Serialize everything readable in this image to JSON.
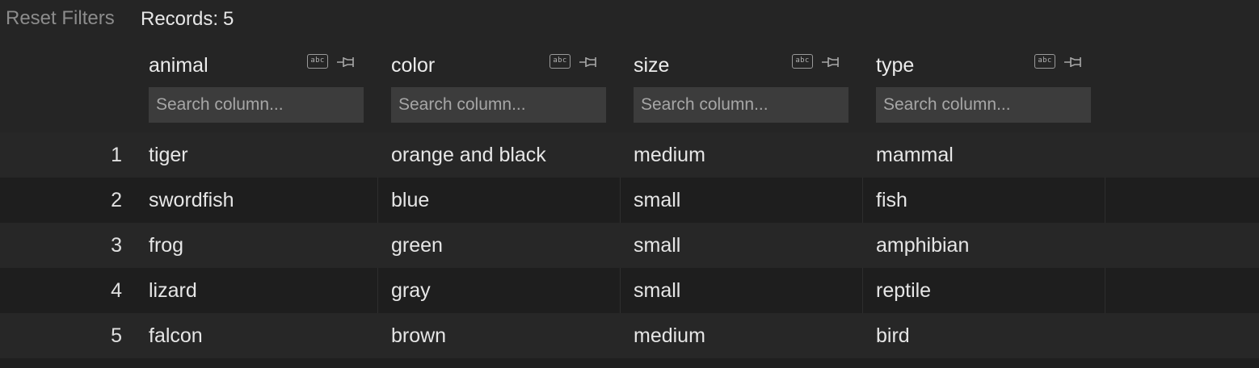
{
  "toolbar": {
    "reset_label": "Reset Filters",
    "records_label": "Records:",
    "records_count": "5"
  },
  "columns": [
    {
      "name": "animal",
      "type_icon_text": "abc",
      "search_placeholder": "Search column..."
    },
    {
      "name": "color",
      "type_icon_text": "abc",
      "search_placeholder": "Search column..."
    },
    {
      "name": "size",
      "type_icon_text": "abc",
      "search_placeholder": "Search column..."
    },
    {
      "name": "type",
      "type_icon_text": "abc",
      "search_placeholder": "Search column..."
    }
  ],
  "rows": [
    {
      "index": "1",
      "cells": [
        "tiger",
        "orange and black",
        "medium",
        "mammal"
      ]
    },
    {
      "index": "2",
      "cells": [
        "swordfish",
        "blue",
        "small",
        "fish"
      ]
    },
    {
      "index": "3",
      "cells": [
        "frog",
        "green",
        "small",
        "amphibian"
      ]
    },
    {
      "index": "4",
      "cells": [
        "lizard",
        "gray",
        "small",
        "reptile"
      ]
    },
    {
      "index": "5",
      "cells": [
        "falcon",
        "brown",
        "medium",
        "bird"
      ]
    }
  ],
  "icons": {
    "type": "text-type-icon",
    "pin": "pin-icon"
  },
  "colors": {
    "background": "#252525",
    "row_dark": "#1e1e1e",
    "row_light": "#272727",
    "input_bg": "#3c3c3c",
    "muted_text": "#8c8c8c"
  }
}
